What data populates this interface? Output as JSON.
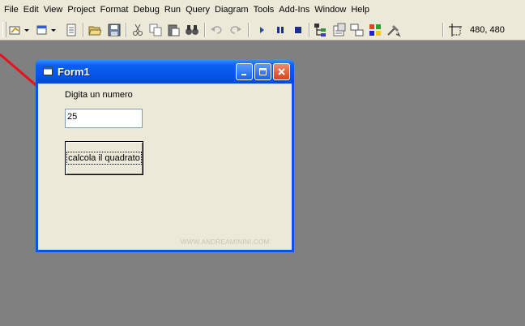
{
  "menubar": {
    "items": [
      "File",
      "Edit",
      "View",
      "Project",
      "Format",
      "Debug",
      "Run",
      "Query",
      "Diagram",
      "Tools",
      "Add-Ins",
      "Window",
      "Help"
    ]
  },
  "toolbar": {
    "coordinates": "480, 480",
    "icons": [
      "add-project-icon",
      "add-form-icon",
      "menu-editor-icon",
      "open-icon",
      "save-icon",
      "cut-icon",
      "copy-icon",
      "paste-icon",
      "find-icon",
      "undo-icon",
      "redo-icon",
      "start-icon",
      "break-icon",
      "end-icon",
      "project-explorer-icon",
      "properties-window-icon",
      "form-layout-icon",
      "object-browser-icon",
      "toolbox-icon",
      "position-icon"
    ]
  },
  "form": {
    "title": "Form1",
    "label": "Digita un numero",
    "input_value": "25",
    "button_label": "calcola il quadrato",
    "watermark": "WWW.ANDREAMININI.COM"
  },
  "colors": {
    "desktop": "#808080",
    "chrome": "#ece9d8",
    "titlebar": "#0a54e3",
    "arrow": "#e8101a"
  }
}
